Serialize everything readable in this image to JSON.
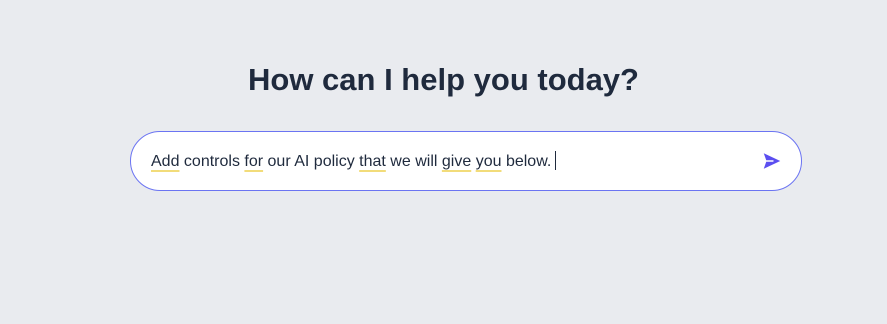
{
  "heading": "How can I help you today?",
  "prompt": {
    "words": [
      {
        "text": "Add",
        "flag": true
      },
      {
        "text": "controls",
        "flag": false
      },
      {
        "text": "for",
        "flag": true
      },
      {
        "text": "our",
        "flag": false
      },
      {
        "text": "AI",
        "flag": false
      },
      {
        "text": "policy",
        "flag": false
      },
      {
        "text": "that",
        "flag": true
      },
      {
        "text": "we",
        "flag": false
      },
      {
        "text": "will",
        "flag": false
      },
      {
        "text": "give",
        "flag": true
      },
      {
        "text": "you",
        "flag": true
      },
      {
        "text": "below.",
        "flag": false
      }
    ]
  },
  "icons": {
    "send": "send-icon"
  },
  "colors": {
    "background": "#e9ebef",
    "accent": "#5b4ef0",
    "input_border": "#6b74f2",
    "spellcheck_underline": "#f2dc7a",
    "heading_text": "#1f2a3d"
  }
}
